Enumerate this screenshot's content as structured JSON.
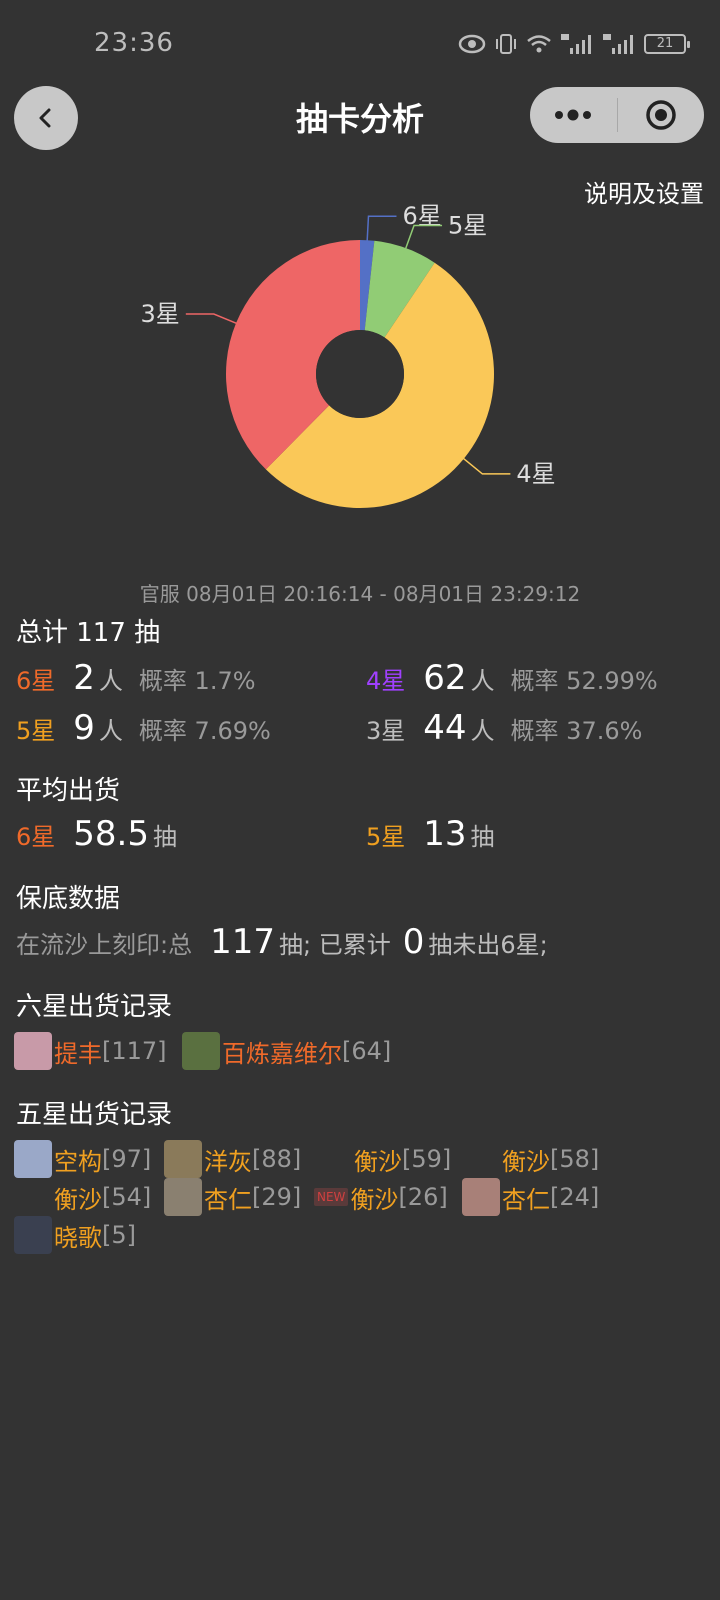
{
  "status": {
    "time": "23:36",
    "battery": "21"
  },
  "nav": {
    "title": "抽卡分析",
    "back_icon": "chevron-left-icon",
    "more_icon": "more-dots-icon",
    "close_icon": "target-circle-icon"
  },
  "settings_link": "说明及设置",
  "chart_data": {
    "type": "pie",
    "donut": true,
    "categories": [
      "6星",
      "5星",
      "4星",
      "3星"
    ],
    "values": [
      2,
      9,
      62,
      44
    ],
    "colors": [
      "#5470c6",
      "#91cc75",
      "#fac858",
      "#ee6666"
    ],
    "legend": "labels-with-leader-lines"
  },
  "time_range": "官服  08月01日 20:16:14  -  08月01日 23:29:12",
  "total": {
    "title": "总计 117 抽"
  },
  "stats": [
    {
      "label": "6星",
      "count": "2",
      "unit": "人",
      "rate": "概率 1.7%",
      "color": "#f06a2a"
    },
    {
      "label": "4星",
      "count": "62",
      "unit": "人",
      "rate": "概率 52.99%",
      "color": "#a040ff"
    },
    {
      "label": "5星",
      "count": "9",
      "unit": "人",
      "rate": "概率 7.69%",
      "color": "#f0a020"
    },
    {
      "label": "3星",
      "count": "44",
      "unit": "人",
      "rate": "概率 37.6%",
      "color": "#bdbdbd"
    }
  ],
  "average": {
    "title": "平均出货",
    "items": [
      {
        "label": "6星",
        "value": "58.5",
        "unit": "抽"
      },
      {
        "label": "5星",
        "value": "13",
        "unit": "抽"
      }
    ]
  },
  "pity": {
    "title": "保底数据",
    "prefix": "在流沙上刻印:总",
    "total": "117",
    "mid": "抽; 已累计",
    "current": "0",
    "suffix": "抽未出6星;"
  },
  "six_star": {
    "title": "六星出货记录",
    "records": [
      {
        "name": "提丰",
        "pulls": "[117]",
        "avatar": "#c89aa8"
      },
      {
        "name": "百炼嘉维尔",
        "pulls": "[64]",
        "avatar": "#5a7040"
      }
    ]
  },
  "five_star": {
    "title": "五星出货记录",
    "new_tag": "NEW",
    "records": [
      {
        "name": "空构",
        "pulls": "[97]",
        "avatar": "#9aa8c8"
      },
      {
        "name": "洋灰",
        "pulls": "[88]",
        "avatar": "#8a7a5a"
      },
      {
        "name": "衡沙",
        "pulls": "[59]",
        "avatar": ""
      },
      {
        "name": "衡沙",
        "pulls": "[58]",
        "avatar": ""
      },
      {
        "name": "衡沙",
        "pulls": "[54]",
        "avatar": ""
      },
      {
        "name": "杏仁",
        "pulls": "[29]",
        "avatar": "#8a8070"
      },
      {
        "name": "衡沙",
        "pulls": "[26]",
        "avatar": ""
      },
      {
        "name": "杏仁",
        "pulls": "[24]",
        "avatar": "#a88078"
      },
      {
        "name": "晓歌",
        "pulls": "[5]",
        "avatar": "#3a4050"
      }
    ]
  }
}
